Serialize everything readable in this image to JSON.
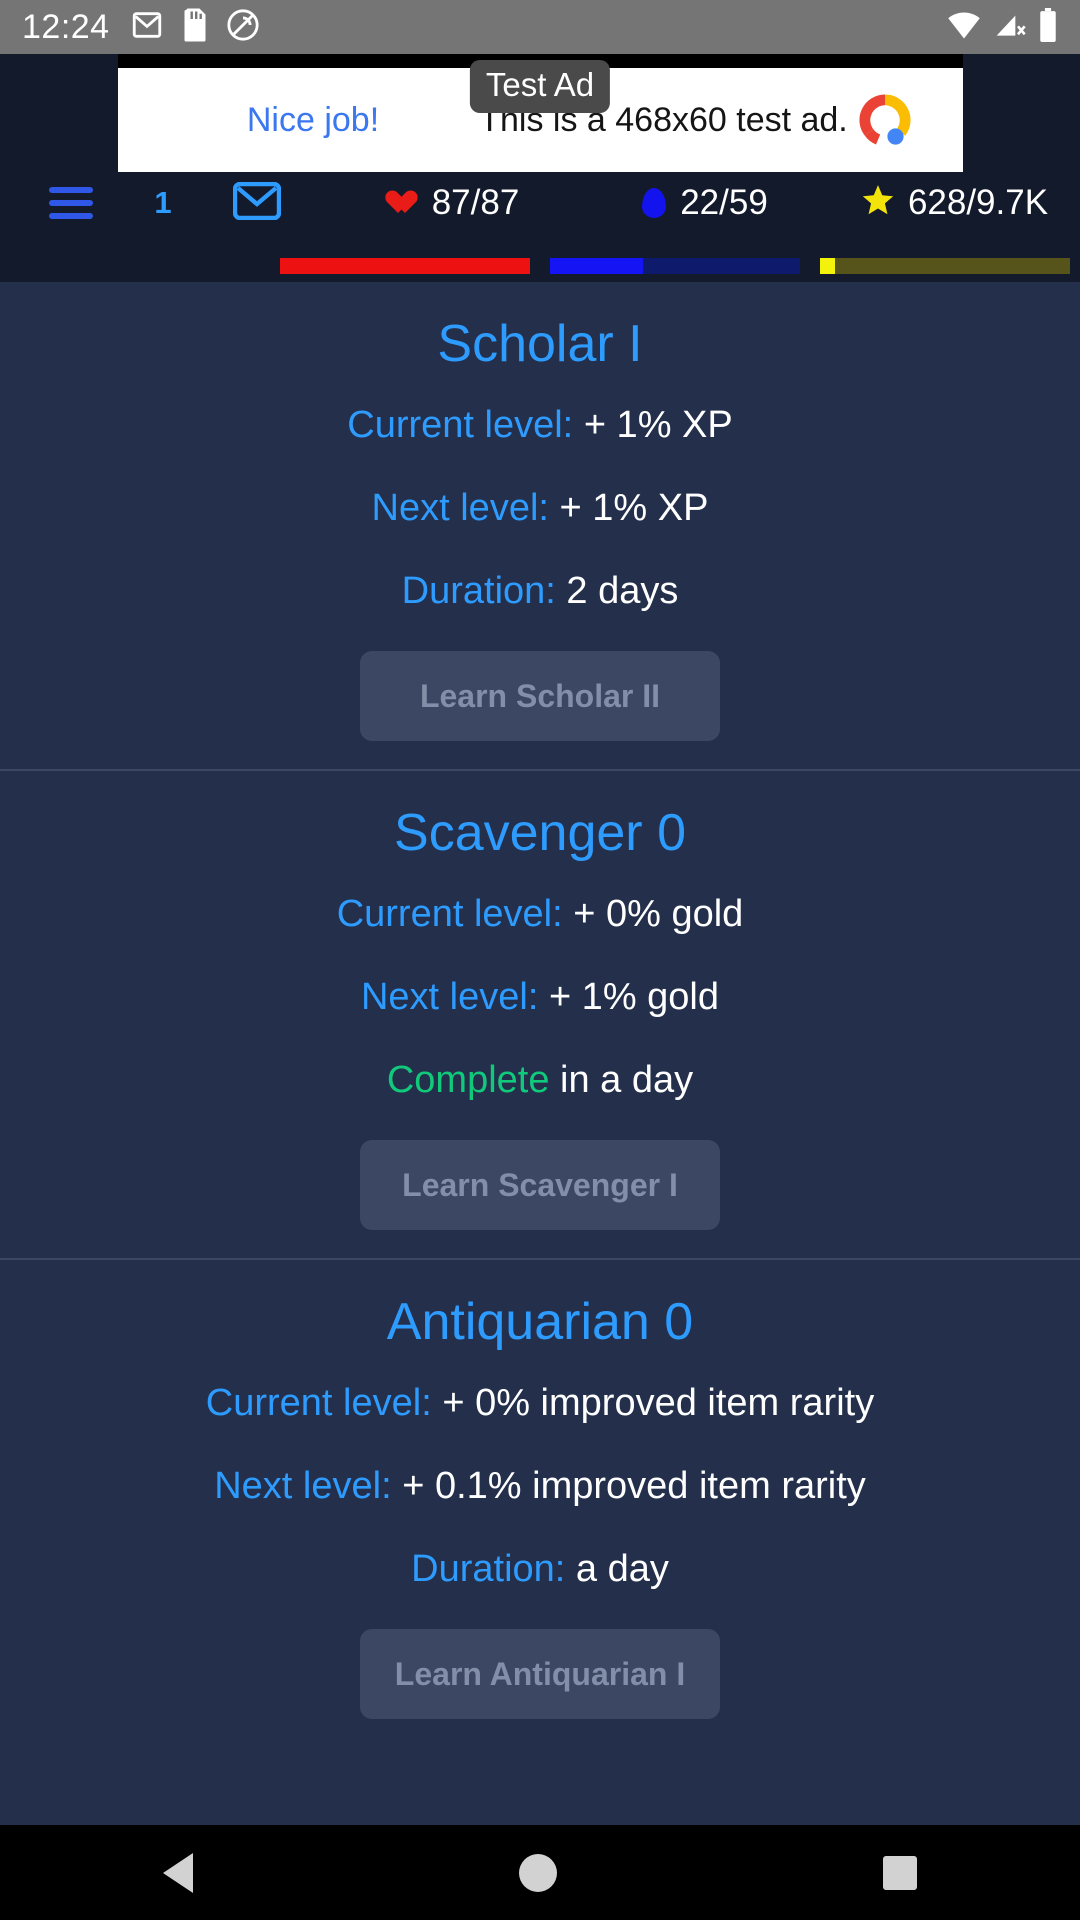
{
  "status_bar": {
    "time": "12:24",
    "left_icons": [
      "gmail-icon",
      "sd-card-icon",
      "no-ads-icon"
    ],
    "right_icons": [
      "wifi-icon",
      "signal-no-service-icon",
      "battery-icon"
    ]
  },
  "ad": {
    "badge": "Test Ad",
    "cta": "Nice job!",
    "body": "This is a 468x60 test ad.",
    "logo": "admob-logo"
  },
  "game_header": {
    "menu_icon": "hamburger-menu-icon",
    "count": "1",
    "mail_icon": "mail-envelope-icon",
    "stats": [
      {
        "icon": "heart-icon",
        "value": "87/87",
        "color": "#ee1111",
        "percent": 100
      },
      {
        "icon": "mana-drop-icon",
        "value": "22/59",
        "color": "#1414f5",
        "percent": 37
      },
      {
        "icon": "star-icon",
        "value": "628/9.7K",
        "color": "#f2f20a",
        "percent": 6
      }
    ]
  },
  "skills": [
    {
      "title": "Scholar I",
      "current_label": "Current level:",
      "current_value": "+ 1% XP",
      "next_label": "Next level:",
      "next_value": "+ 1% XP",
      "duration_label": "Duration:",
      "duration_value": "2 days",
      "duration_label_color": "#2e9bff",
      "button": "Learn Scholar II"
    },
    {
      "title": "Scavenger 0",
      "current_label": "Current level:",
      "current_value": "+ 0% gold",
      "next_label": "Next level:",
      "next_value": "+ 1% gold",
      "duration_label": "Complete",
      "duration_value": "in a day",
      "duration_label_color": "#11c97b",
      "button": "Learn Scavenger I"
    },
    {
      "title": "Antiquarian 0",
      "current_label": "Current level:",
      "current_value": "+ 0% improved item rarity",
      "next_label": "Next level:",
      "next_value": "+ 0.1% improved item rarity",
      "duration_label": "Duration:",
      "duration_value": "a day",
      "duration_label_color": "#2e9bff",
      "button": "Learn Antiquarian I"
    }
  ],
  "nav_bar": {
    "back": "back-triangle-icon",
    "home": "home-circle-icon",
    "recents": "recents-square-icon"
  }
}
